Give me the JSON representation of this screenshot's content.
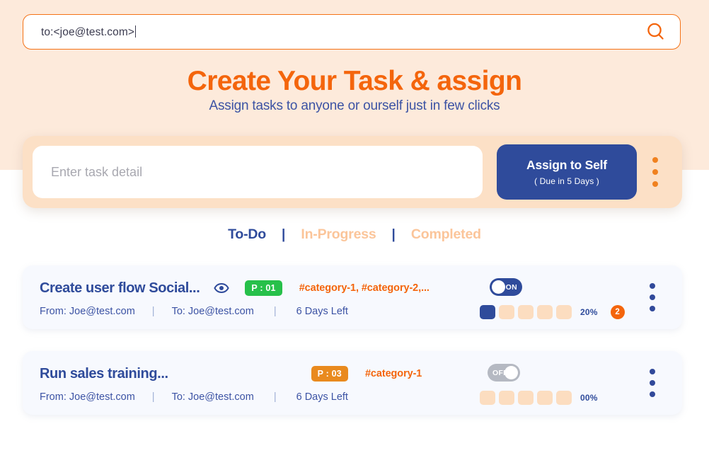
{
  "search": {
    "value": "to:<joe@test.com>",
    "icon": "search-icon"
  },
  "hero": {
    "title": "Create Your Task & assign",
    "subtitle": "Assign tasks to anyone or ourself just in few clicks"
  },
  "entry": {
    "placeholder": "Enter task detail",
    "assign_button": {
      "main": "Assign to Self",
      "sub": "( Due in 5 Days )"
    },
    "menu_icon": "more-vertical-icon"
  },
  "tabs": {
    "separator": "|",
    "items": [
      {
        "label": "To-Do",
        "active": true
      },
      {
        "label": "In-Progress",
        "active": false
      },
      {
        "label": "Completed",
        "active": false
      }
    ]
  },
  "colors": {
    "brand_orange": "#f4650c",
    "brand_blue": "#2f4b9b",
    "header_band": "#fdeadb",
    "entry_card": "#fce0c6",
    "priority_green": "#27c04a",
    "priority_orange": "#e98a1e",
    "toggle_off": "#b5b9c2",
    "segment_empty": "#fcddc0"
  },
  "tasks": [
    {
      "title": "Create user flow Social...",
      "has_eye_icon": true,
      "eye_icon": "eye-icon",
      "priority": "P : 01",
      "priority_color": "#27c04a",
      "categories": "#category-1, #category-2,...",
      "toggle": {
        "state": "on",
        "label": "ON"
      },
      "from": "From: Joe@test.com",
      "to": "To: Joe@test.com",
      "days_left": "6 Days Left",
      "separator": "|",
      "progress": {
        "percent_label": "20%",
        "filled": 1,
        "total": 5
      },
      "count_badge": "2",
      "menu_icon": "more-vertical-icon"
    },
    {
      "title": "Run sales training...",
      "has_eye_icon": false,
      "eye_icon": "",
      "priority": "P : 03",
      "priority_color": "#e98a1e",
      "categories": "#category-1",
      "toggle": {
        "state": "off",
        "label": "OFF"
      },
      "from": "From: Joe@test.com",
      "to": "To: Joe@test.com",
      "days_left": "6 Days Left",
      "separator": "|",
      "progress": {
        "percent_label": "00%",
        "filled": 0,
        "total": 5
      },
      "count_badge": "",
      "menu_icon": "more-vertical-icon"
    }
  ]
}
